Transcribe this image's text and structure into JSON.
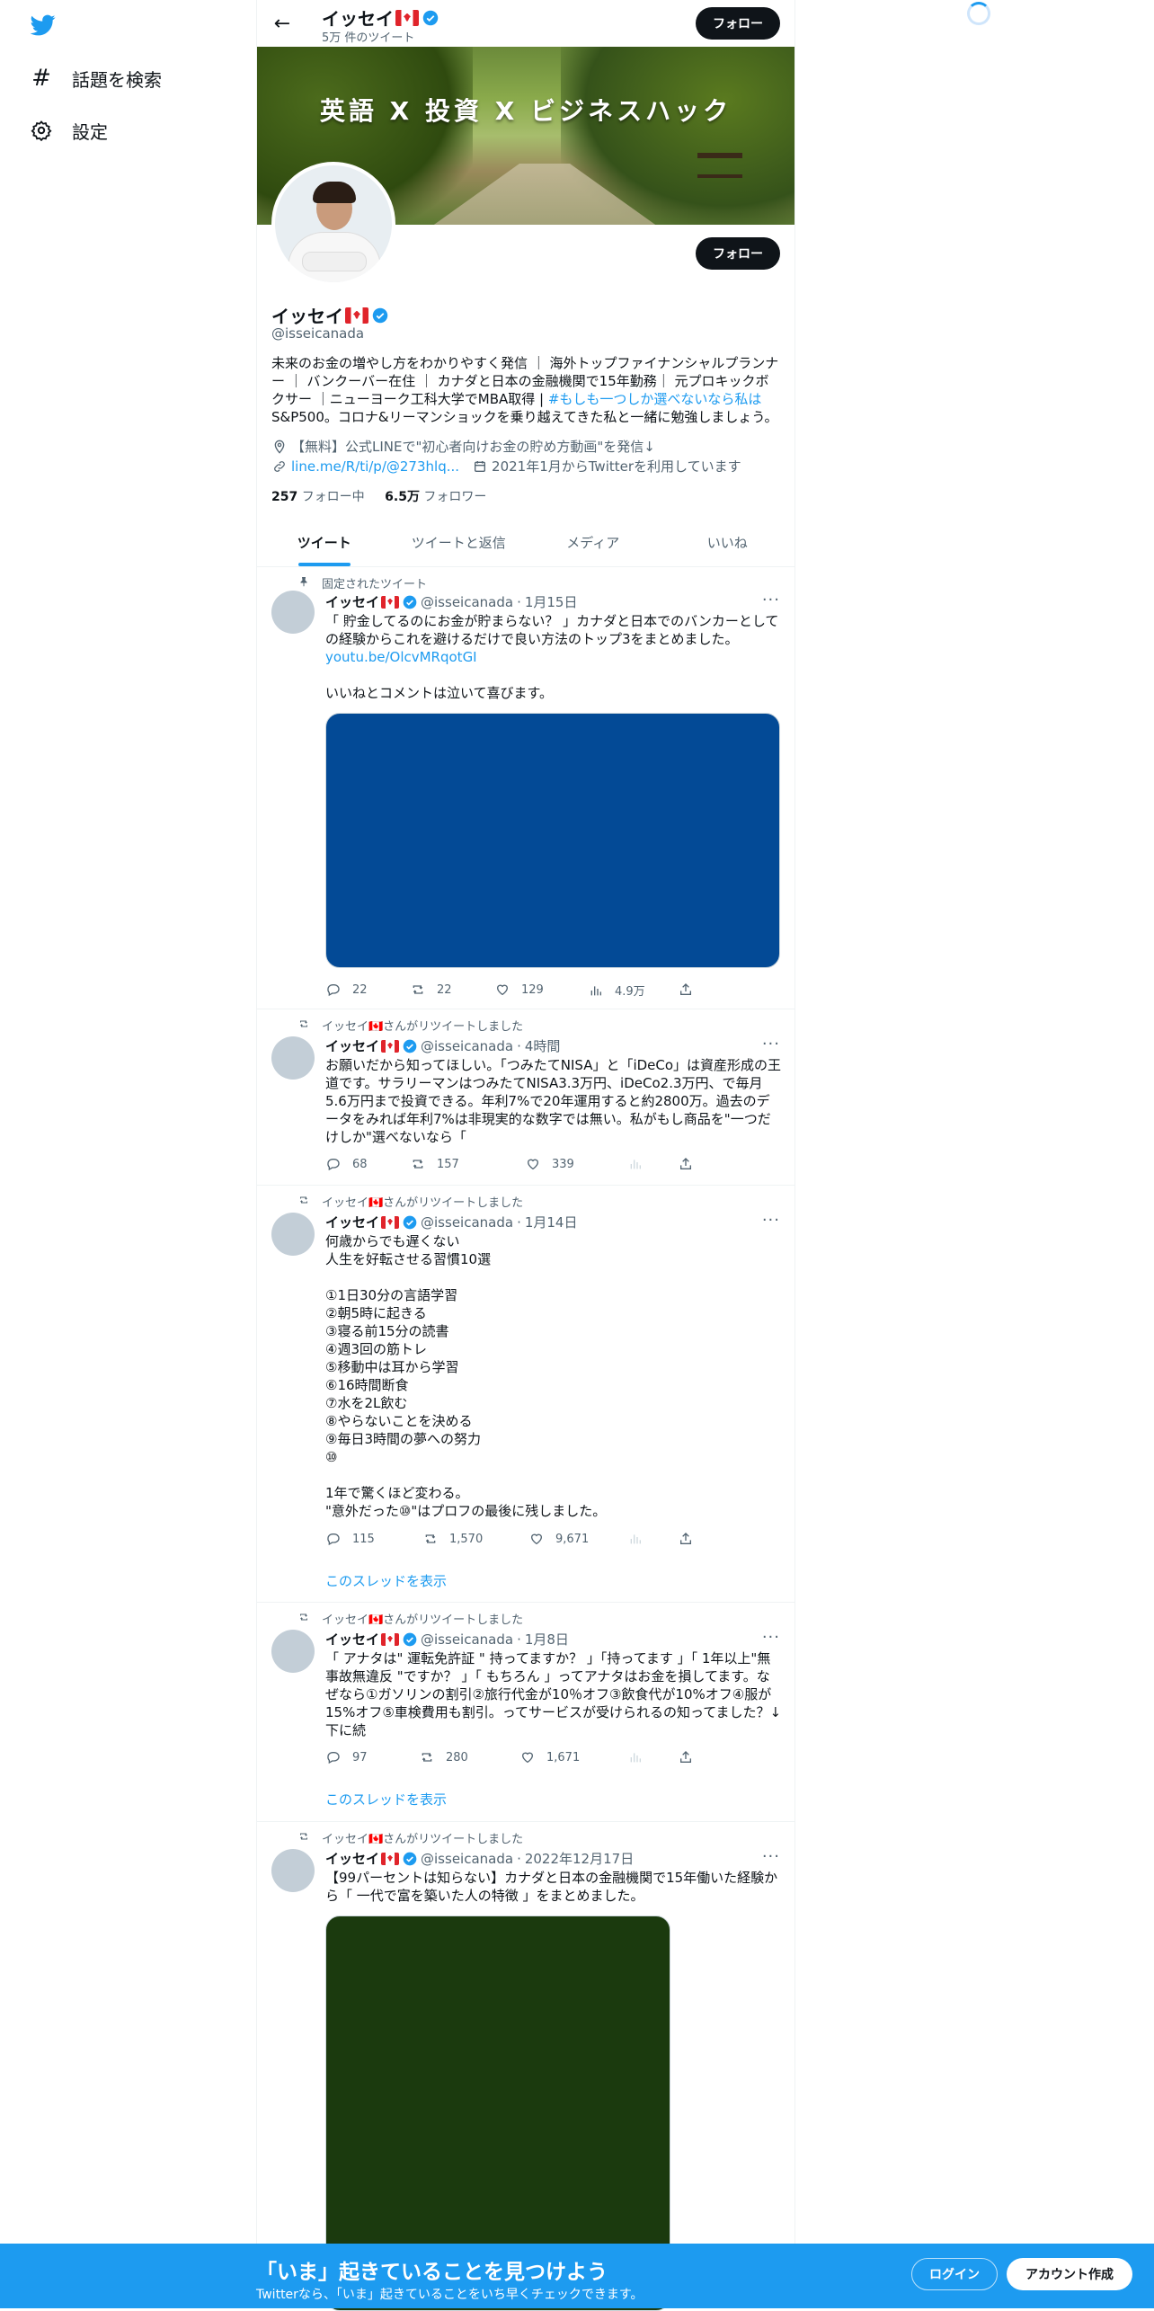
{
  "sidebar": {
    "logo": "twitter-bird-icon",
    "items": [
      {
        "icon": "hashtag-icon",
        "label": "話題を検索"
      },
      {
        "icon": "gear-icon",
        "label": "設定"
      }
    ]
  },
  "header": {
    "name": "イッセイ",
    "tweet_count": "5万 件のツイート",
    "follow_label": "フォロー"
  },
  "banner": {
    "text": "英語 X 投資 X ビジネスハック"
  },
  "profile": {
    "name": "イッセイ",
    "handle": "@isseicanada",
    "follow_label": "フォロー",
    "bio_text": "未来のお金の増やし方をわかりやすく発信 ｜ 海外トップファイナンシャルプランナー ｜ バンクーバー在住 ｜ カナダと日本の金融機関で15年勤務｜ 元プロキックボクサー ｜ニューヨーク工科大学でMBA取得 | ",
    "bio_link": "#もしも一つしか選べないなら私は",
    "bio_tail": "S&P500。コロナ&リーマンショックを乗り越えてきた私と一緒に勉強しましょう。",
    "location": "【無料】公式LINEで\"初心者向けお金の貯め方動画\"を発信↓",
    "url": "line.me/R/ti/p/@273hlq...",
    "joined": "2021年1月からTwitterを利用しています",
    "following_count": "257",
    "following_label": "フォロー中",
    "followers_count": "6.5万",
    "followers_label": "フォロワー"
  },
  "tabs": [
    "ツイート",
    "ツイートと返信",
    "メディア",
    "いいね"
  ],
  "colors": {
    "accent": "#1d9bf0",
    "media_blue": "#034a96",
    "media_green": "#1b3a0e"
  },
  "tweets": [
    {
      "context": "固定されたツイート",
      "name": "イッセイ",
      "handle": "@isseicanada",
      "date": "1月15日",
      "text": "「 貯金してるのにお金が貯まらない？ 」カナダと日本でのバンカーとしての経験からこれを避けるだけで良い方法のトップ3をまとめました。",
      "link": "youtu.be/OlcvMRqotGI",
      "text2": "いいねとコメントは泣いて喜びます。",
      "replies": "22",
      "retweets": "22",
      "likes": "129",
      "views": "4.9万"
    },
    {
      "context": "イッセイ🇨🇦さんがリツイートしました",
      "name": "イッセイ",
      "handle": "@isseicanada",
      "date": "4時間",
      "text": "お願いだから知ってほしい。「つみたてNISA」と「iDeCo」は資産形成の王道です。サラリーマンはつみたてNISA3.3万円、iDeCo2.3万円、で毎月5.6万円まで投資できる。年利7%で20年運用すると約2800万。過去のデータをみれば年利7%は非現実的な数字では無い。私がもし商品を\"一つだけしか\"選べないなら「",
      "replies": "68",
      "retweets": "157",
      "likes": "339"
    },
    {
      "context": "イッセイ🇨🇦さんがリツイートしました",
      "name": "イッセイ",
      "handle": "@isseicanada",
      "date": "1月14日",
      "text": "何歳からでも遅くない\n人生を好転させる習慣10選\n\n①1日30分の言語学習\n②朝5時に起きる\n③寝る前15分の読書\n④週3回の筋トレ\n⑤移動中は耳から学習\n⑥16時間断食\n⑦水を2L飲む\n⑧やらないことを決める\n⑨毎日3時間の夢への努力\n⑩\n\n1年で驚くほど変わる。\n\"意外だった⑩\"はプロフの最後に残しました。",
      "replies": "115",
      "retweets": "1,570",
      "likes": "9,671",
      "thread": "このスレッドを表示"
    },
    {
      "context": "イッセイ🇨🇦さんがリツイートしました",
      "name": "イッセイ",
      "handle": "@isseicanada",
      "date": "1月8日",
      "text": "「 アナタは\" 運転免許証 \" 持ってますか？ 」「持ってます 」「 1年以上\"無事故無違反 \"ですか？ 」「 もちろん 」ってアナタはお金を損してます。なぜなら①ガソリンの割引②旅行代金が10％オフ③飲食代が10%オフ④服が15%オフ⑤車検費用も割引。ってサービスが受けられるの知ってました？↓下に続",
      "replies": "97",
      "retweets": "280",
      "likes": "1,671",
      "thread": "このスレッドを表示"
    },
    {
      "context": "イッセイ🇨🇦さんがリツイートしました",
      "name": "イッセイ",
      "handle": "@isseicanada",
      "date": "2022年12月17日",
      "text": "【99パーセントは知らない】カナダと日本の金融機関で15年働いた経験から「 一代で富を築いた人の特徴 」をまとめました。"
    }
  ],
  "bottom_bar": {
    "title": "「いま」起きていることを見つけよう",
    "subtitle": "Twitterなら、「いま」起きていることをいち早くチェックできます。",
    "login": "ログイン",
    "signup": "アカウント作成"
  }
}
